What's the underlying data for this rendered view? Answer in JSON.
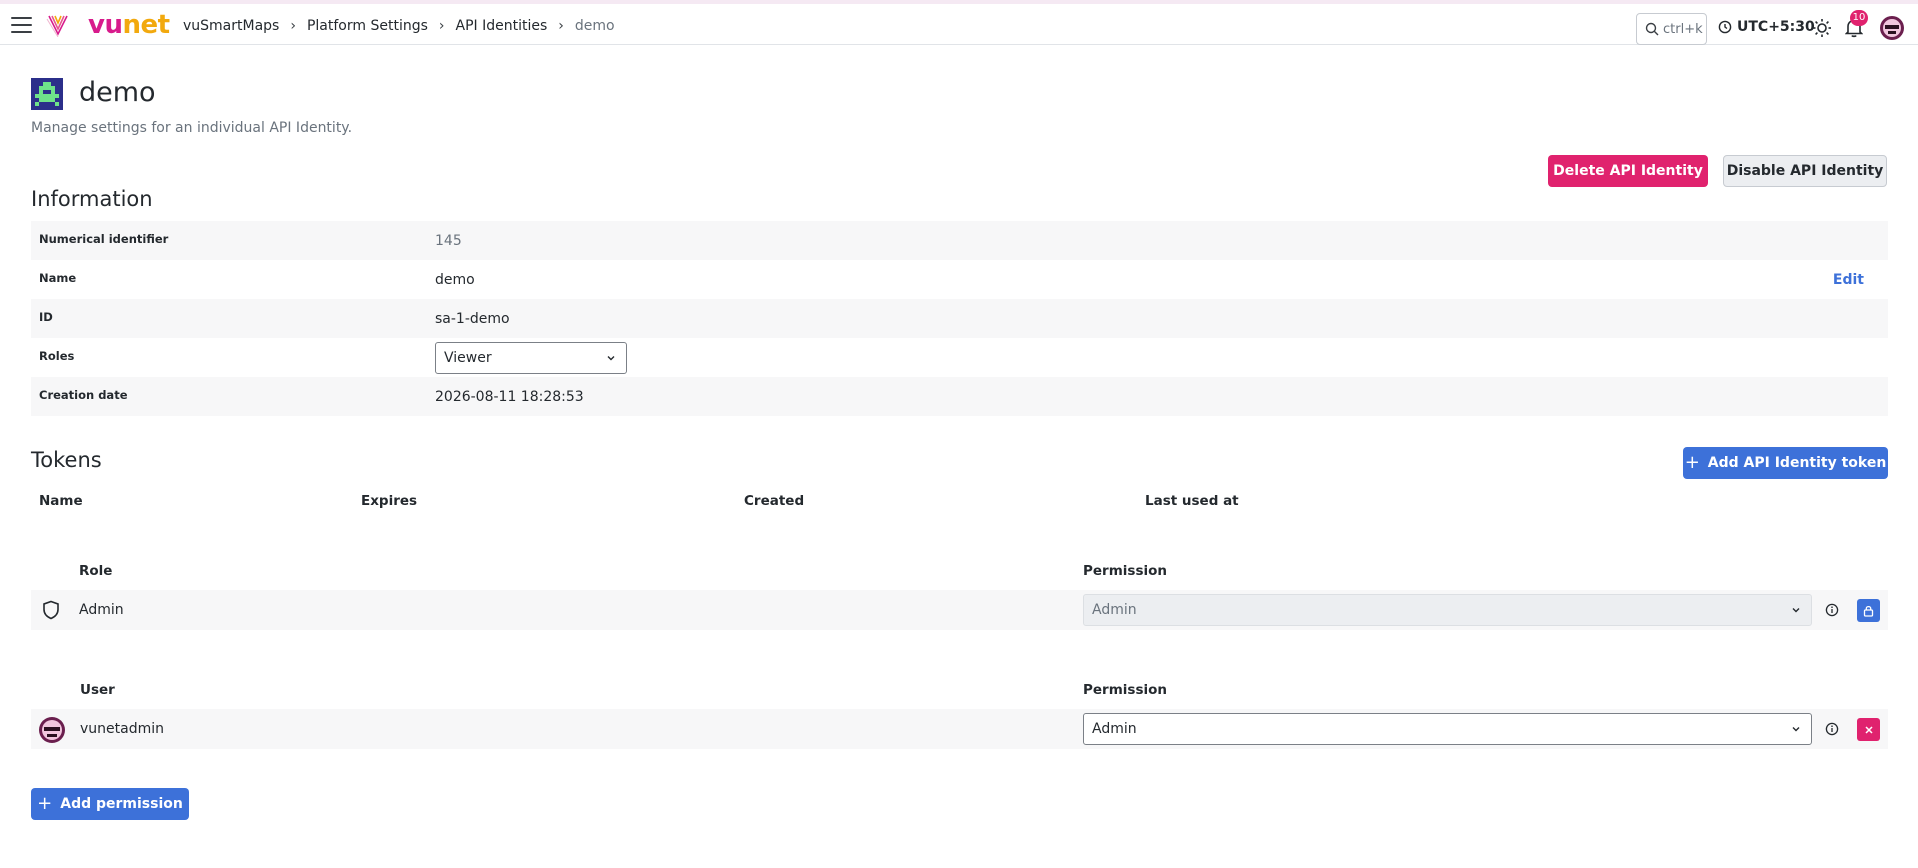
{
  "brand": {
    "logo_part1": "vu",
    "logo_part2": "net",
    "accent": "#d81b8c",
    "accent2": "#f2a90e"
  },
  "breadcrumb": {
    "items": [
      "vuSmartMaps",
      "Platform Settings",
      "API Identities"
    ],
    "current": "demo"
  },
  "topbar": {
    "search_placeholder": "ctrl+k",
    "timezone": "UTC+5:30",
    "notification_count": "10",
    "icons": [
      "menu-icon",
      "search-icon",
      "clock-icon",
      "sun-icon",
      "bell-icon",
      "avatar"
    ]
  },
  "page": {
    "title": "demo",
    "subtitle": "Manage settings for an individual API Identity."
  },
  "actions": {
    "delete_label": "Delete API Identity",
    "disable_label": "Disable API Identity"
  },
  "information": {
    "heading": "Information",
    "rows": [
      {
        "label": "Numerical identifier",
        "value": "145"
      },
      {
        "label": "Name",
        "value": "demo",
        "action": "Edit"
      },
      {
        "label": "ID",
        "value": "sa-1-demo"
      },
      {
        "label": "Roles",
        "value": "Viewer"
      },
      {
        "label": "Creation date",
        "value": "2026-08-11 18:28:53"
      }
    ]
  },
  "tokens": {
    "heading": "Tokens",
    "add_label": "Add API Identity token",
    "columns": [
      "Name",
      "Expires",
      "Created",
      "Last used at"
    ]
  },
  "permissions": {
    "role_section": {
      "col1": "Role",
      "col2": "Permission",
      "row": {
        "name": "Admin",
        "permission": "Admin",
        "locked": true
      }
    },
    "user_section": {
      "col1": "User",
      "col2": "Permission",
      "row": {
        "name": "vunetadmin",
        "permission": "Admin",
        "locked": false
      }
    },
    "add_label": "Add permission"
  },
  "colors": {
    "primary": "#3d71d9",
    "danger": "#e0226e",
    "row_bg": "#f7f7f8"
  }
}
